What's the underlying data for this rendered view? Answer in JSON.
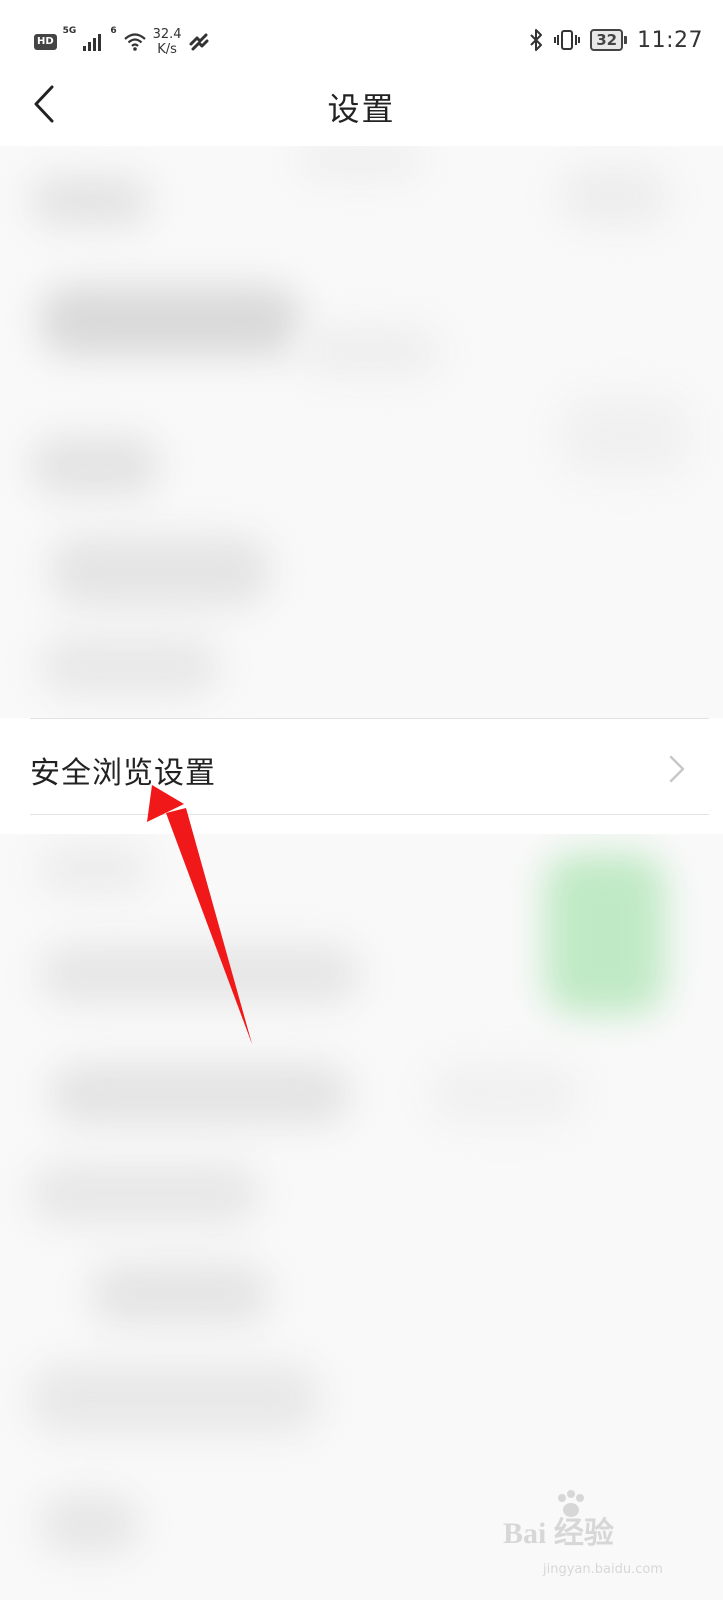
{
  "status_bar": {
    "hd": "HD",
    "net_5g": "5G",
    "net_6": "6",
    "speed_value": "32.4",
    "speed_unit": "K/s",
    "battery": "32",
    "time": "11:27"
  },
  "header": {
    "title": "设置"
  },
  "highlighted_item": {
    "label": "安全浏览设置"
  },
  "watermark": {
    "brand": "Bai 经验",
    "url": "jingyan.baidu.com"
  },
  "colors": {
    "annotation_arrow": "#f01818",
    "blurred_toggle": "#bfe9c4",
    "background": "#fbfbfb"
  },
  "icons": [
    "back-arrow-icon",
    "chevron-right-icon",
    "bluetooth-icon",
    "vibrate-icon",
    "wifi-icon",
    "signal-icon",
    "battery-icon",
    "hotspot-icon"
  ]
}
